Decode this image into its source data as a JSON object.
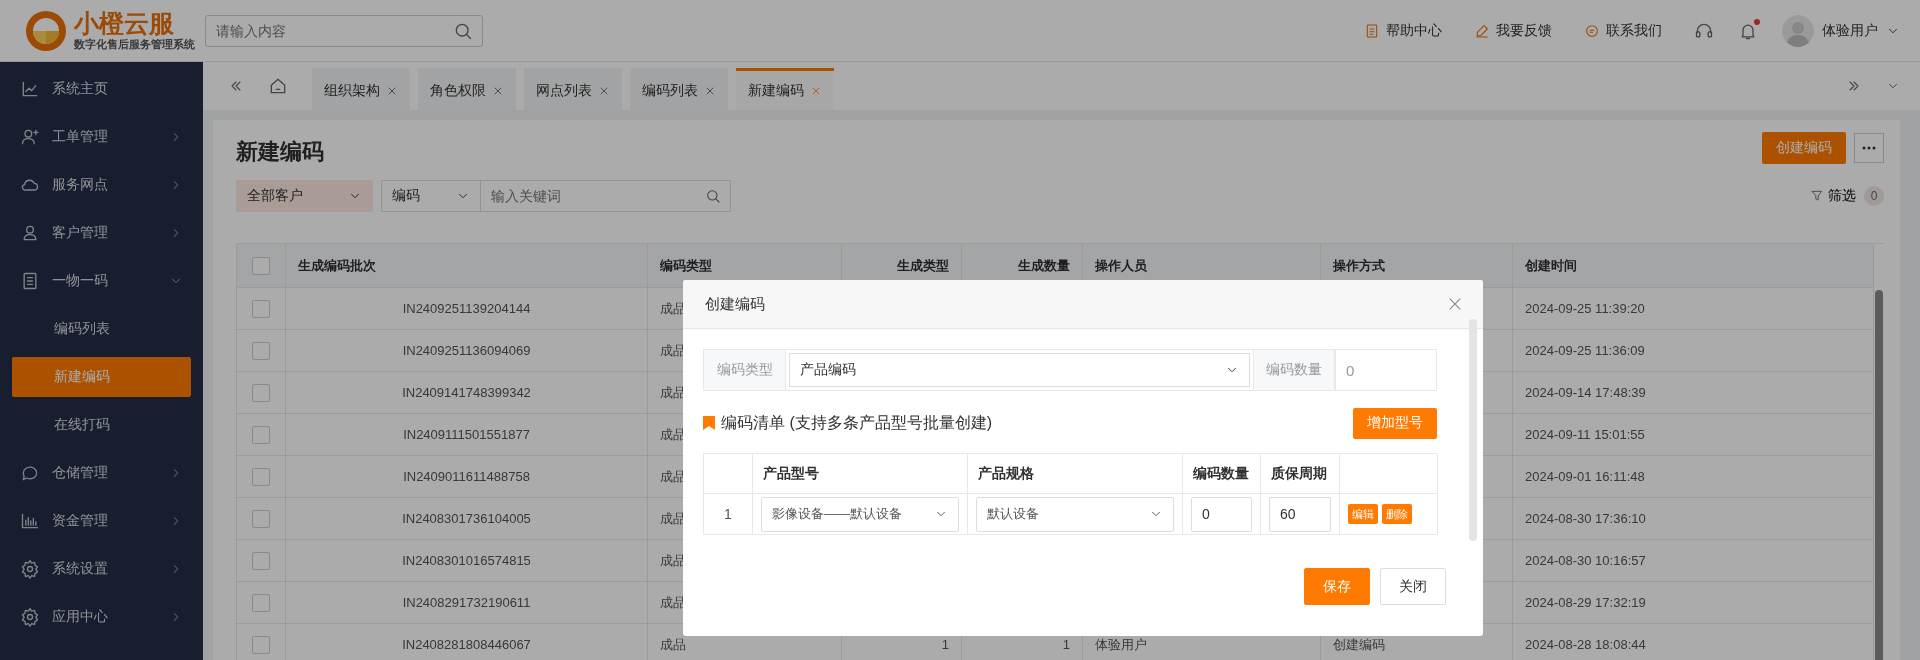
{
  "header": {
    "logo": {
      "name": "小橙云服",
      "tagline": "数字化售后服务管理系统"
    },
    "search": {
      "placeholder": "请输入内容"
    },
    "links": [
      "帮助中心",
      "我要反馈",
      "联系我们"
    ],
    "notifications": {
      "unread": true
    },
    "user": {
      "name": "体验用户"
    }
  },
  "sidebar": {
    "items": [
      {
        "label": "系统主页",
        "selected": false
      },
      {
        "label": "工单管理",
        "selected": false,
        "expanded": false
      },
      {
        "label": "服务网点",
        "selected": false,
        "expanded": false
      },
      {
        "label": "客户管理",
        "selected": false,
        "expanded": false
      },
      {
        "label": "一物一码",
        "selected": false,
        "expanded": true,
        "children": [
          {
            "label": "编码列表",
            "selected": false
          },
          {
            "label": "新建编码",
            "selected": true
          },
          {
            "label": "在线打码",
            "selected": false
          }
        ]
      },
      {
        "label": "仓储管理",
        "selected": false,
        "expanded": false
      },
      {
        "label": "资金管理",
        "selected": false,
        "expanded": false
      },
      {
        "label": "系统设置",
        "selected": false,
        "expanded": false
      },
      {
        "label": "应用中心",
        "selected": false,
        "expanded": false
      }
    ]
  },
  "tabs": [
    {
      "label": "组织架构",
      "selected": false
    },
    {
      "label": "角色权限",
      "selected": false
    },
    {
      "label": "网点列表",
      "selected": false
    },
    {
      "label": "编码列表",
      "selected": false
    },
    {
      "label": "新建编码",
      "selected": true
    }
  ],
  "page": {
    "title": "新建编码",
    "create_button": "创建编码",
    "filters": {
      "customer": "全部客户",
      "field": "编码",
      "placeholder": "输入关键词"
    },
    "filter_button": "筛选",
    "filter_count": "0"
  },
  "table": {
    "select_all": {
      "checked": false
    },
    "columns": [
      "生成编码批次",
      "编码类型",
      "生成类型",
      "生成数量",
      "操作人员",
      "操作方式",
      "创建时间"
    ],
    "rows": [
      {
        "checked": false,
        "cells": [
          "IN2409251139204144",
          "成品",
          null,
          null,
          null,
          null,
          "2024-09-25 11:39:20"
        ]
      },
      {
        "checked": false,
        "cells": [
          "IN2409251136094069",
          "成品",
          null,
          null,
          null,
          null,
          "2024-09-25 11:36:09"
        ]
      },
      {
        "checked": false,
        "cells": [
          "IN2409141748399342",
          "成品",
          null,
          null,
          null,
          null,
          "2024-09-14 17:48:39"
        ]
      },
      {
        "checked": false,
        "cells": [
          "IN2409111501551877",
          "成品",
          null,
          null,
          null,
          null,
          "2024-09-11 15:01:55"
        ]
      },
      {
        "checked": false,
        "cells": [
          "IN2409011611488758",
          "成品",
          null,
          null,
          null,
          null,
          "2024-09-01 16:11:48"
        ]
      },
      {
        "checked": false,
        "cells": [
          "IN2408301736104005",
          "成品",
          null,
          null,
          null,
          null,
          "2024-08-30 17:36:10"
        ]
      },
      {
        "checked": false,
        "cells": [
          "IN2408301016574815",
          "成品",
          null,
          null,
          null,
          null,
          "2024-08-30 10:16:57"
        ]
      },
      {
        "checked": false,
        "cells": [
          "IN2408291732190611",
          "成品",
          null,
          null,
          null,
          null,
          "2024-08-29 17:32:19"
        ]
      },
      {
        "checked": false,
        "cells": [
          "IN2408281808446067",
          "成品",
          "1",
          "1",
          "体验用户",
          "创建编码",
          "2024-08-28 18:08:44"
        ]
      }
    ]
  },
  "modal": {
    "title": "创建编码",
    "code_type_label": "编码类型",
    "code_type": "产品编码",
    "count_label": "编码数量",
    "count": "0",
    "section_title": "编码清单 (支持多条产品型号批量创建)",
    "add_button": "增加型号",
    "columns": [
      "产品型号",
      "产品规格",
      "编码数量",
      "质保周期"
    ],
    "rows": [
      {
        "index": "1",
        "model": "影像设备——默认设备",
        "spec": "默认设备",
        "count": "0",
        "warranty": "60",
        "actions": [
          "编辑",
          "删除"
        ]
      }
    ],
    "buttons": [
      {
        "label": "保存",
        "kind": "primary"
      },
      {
        "label": "关闭",
        "kind": "default"
      }
    ]
  }
}
